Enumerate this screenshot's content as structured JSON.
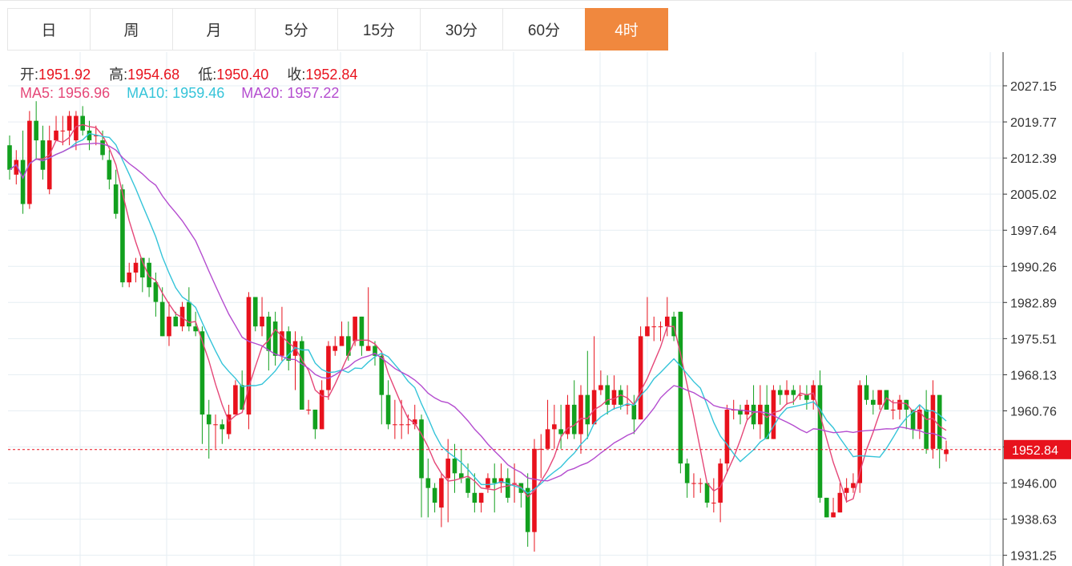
{
  "tabs": [
    {
      "label": "日",
      "active": false
    },
    {
      "label": "周",
      "active": false
    },
    {
      "label": "月",
      "active": false
    },
    {
      "label": "5分",
      "active": false
    },
    {
      "label": "15分",
      "active": false
    },
    {
      "label": "30分",
      "active": false
    },
    {
      "label": "60分",
      "active": false
    },
    {
      "label": "4时",
      "active": true
    }
  ],
  "ohlc": {
    "open_label": "开:",
    "open": "1951.92",
    "high_label": "高:",
    "high": "1954.68",
    "low_label": "低:",
    "low": "1950.40",
    "close_label": "收:",
    "close": "1952.84"
  },
  "ma": {
    "ma5_label": "MA5:",
    "ma5": "1956.96",
    "ma10_label": "MA10:",
    "ma10": "1959.46",
    "ma20_label": "MA20:",
    "ma20": "1957.22"
  },
  "colors": {
    "up": "#e8121d",
    "down": "#12a01e",
    "ma5": "#e54778",
    "ma10": "#35c4d9",
    "ma20": "#b44ccf",
    "grid": "#e6eef3",
    "active_tab": "#f0883e"
  },
  "chart_data": {
    "type": "candlestick",
    "y_ticks": [
      "2027.15",
      "2019.77",
      "2012.39",
      "2005.02",
      "1997.64",
      "1990.26",
      "1982.89",
      "1975.51",
      "1968.13",
      "1960.76",
      "1953.38",
      "1946.00",
      "1938.63",
      "1931.25"
    ],
    "ylim": [
      1931.25,
      2027.15
    ],
    "last_price": "1952.84",
    "candles": [
      [
        2015,
        2010,
        2017,
        2008
      ],
      [
        2009,
        2012,
        2014,
        2007
      ],
      [
        2012,
        2003,
        2018,
        2001
      ],
      [
        2003,
        2020,
        2022,
        2002
      ],
      [
        2020,
        2016,
        2024,
        2012
      ],
      [
        2016,
        2010,
        2019,
        2008
      ],
      [
        2006,
        2016,
        2019,
        2005
      ],
      [
        2016,
        2018,
        2021,
        2016
      ],
      [
        2018,
        2018,
        2021,
        2015
      ],
      [
        2018,
        2021,
        2022,
        2015
      ],
      [
        2016,
        2021,
        2022,
        2014
      ],
      [
        2021,
        2018,
        2023,
        2017
      ],
      [
        2018,
        2016,
        2020,
        2014
      ],
      [
        2017,
        2017,
        2019,
        2015
      ],
      [
        2016,
        2013,
        2018,
        2012
      ],
      [
        2012,
        2008,
        2014,
        2006
      ],
      [
        2007,
        2001,
        2010,
        2000
      ],
      [
        2006,
        1987,
        2007,
        1986
      ],
      [
        1987,
        1989,
        1991,
        1986
      ],
      [
        1989,
        1991,
        1992,
        1987
      ],
      [
        1992,
        1988,
        1992,
        1985
      ],
      [
        1991,
        1986,
        1992,
        1984
      ],
      [
        1987,
        1983,
        1989,
        1980
      ],
      [
        1983,
        1976,
        1986,
        1976
      ],
      [
        1976,
        1980,
        1983,
        1974
      ],
      [
        1980,
        1978,
        1981,
        1978
      ],
      [
        1978,
        1982,
        1983,
        1977
      ],
      [
        1983,
        1978,
        1986,
        1977
      ],
      [
        1978,
        1977,
        1981,
        1976
      ],
      [
        1977,
        1960,
        1978,
        1954
      ],
      [
        1960,
        1958,
        1963,
        1951
      ],
      [
        1958,
        1958,
        1960,
        1953
      ],
      [
        1958,
        1957,
        1959,
        1954
      ],
      [
        1956,
        1960,
        1962,
        1955
      ],
      [
        1960,
        1966,
        1967,
        1960
      ],
      [
        1966,
        1961,
        1969,
        1961
      ],
      [
        1960,
        1984,
        1985,
        1957
      ],
      [
        1984,
        1978,
        1984,
        1977
      ],
      [
        1978,
        1980,
        1984,
        1976
      ],
      [
        1980,
        1973,
        1981,
        1969
      ],
      [
        1979,
        1972,
        1981,
        1970
      ],
      [
        1972,
        1977,
        1982,
        1971
      ],
      [
        1977,
        1971,
        1978,
        1969
      ],
      [
        1972,
        1975,
        1977,
        1965
      ],
      [
        1975,
        1961,
        1976,
        1961
      ],
      [
        1961,
        1961,
        1963,
        1960
      ],
      [
        1961,
        1957,
        1961,
        1955
      ],
      [
        1957,
        1965,
        1967,
        1957
      ],
      [
        1965,
        1974,
        1975,
        1963
      ],
      [
        1973,
        1974,
        1976,
        1972
      ],
      [
        1974,
        1976,
        1979,
        1975
      ],
      [
        1976,
        1972,
        1979,
        1971
      ],
      [
        1975,
        1980,
        1980,
        1974
      ],
      [
        1980,
        1974,
        1980,
        1972
      ],
      [
        1973,
        1974,
        1986,
        1973
      ],
      [
        1974,
        1972,
        1975,
        1970
      ],
      [
        1972,
        1964,
        1973,
        1958
      ],
      [
        1964,
        1958,
        1967,
        1957
      ],
      [
        1958,
        1958,
        1963,
        1955
      ],
      [
        1958,
        1958,
        1963,
        1955
      ],
      [
        1958,
        1958,
        1960,
        1956
      ],
      [
        1958,
        1959,
        1962,
        1957
      ],
      [
        1959,
        1947,
        1960,
        1939
      ],
      [
        1947,
        1945,
        1951,
        1939
      ],
      [
        1945,
        1942,
        1946,
        1940
      ],
      [
        1941,
        1947,
        1948,
        1937
      ],
      [
        1947,
        1951,
        1955,
        1938
      ],
      [
        1951,
        1948,
        1954,
        1944
      ],
      [
        1948,
        1947,
        1953,
        1946
      ],
      [
        1947,
        1944,
        1950,
        1943
      ],
      [
        1944,
        1942,
        1948,
        1940
      ],
      [
        1942,
        1944,
        1944,
        1940
      ],
      [
        1945,
        1947,
        1948,
        1944
      ],
      [
        1947,
        1946,
        1950,
        1940
      ],
      [
        1946,
        1947,
        1950,
        1944
      ],
      [
        1947,
        1943,
        1949,
        1942
      ],
      [
        1946,
        1946,
        1950,
        1942
      ],
      [
        1946,
        1944,
        1946,
        1941
      ],
      [
        1945,
        1936,
        1948,
        1933
      ],
      [
        1936,
        1953,
        1955,
        1932
      ],
      [
        1953,
        1953,
        1956,
        1947
      ],
      [
        1953,
        1957,
        1963,
        1956
      ],
      [
        1957,
        1958,
        1962,
        1953
      ],
      [
        1957,
        1956,
        1962,
        1953
      ],
      [
        1956,
        1962,
        1964,
        1955
      ],
      [
        1962,
        1956,
        1967,
        1955
      ],
      [
        1956,
        1964,
        1966,
        1952
      ],
      [
        1964,
        1958,
        1973,
        1955
      ],
      [
        1958,
        1965,
        1976,
        1962
      ],
      [
        1965,
        1966,
        1969,
        1964
      ],
      [
        1966,
        1962,
        1968,
        1960
      ],
      [
        1962,
        1965,
        1968,
        1961
      ],
      [
        1965,
        1962,
        1966,
        1961
      ],
      [
        1962,
        1962,
        1966,
        1960
      ],
      [
        1962,
        1959,
        1964,
        1956
      ],
      [
        1959,
        1976,
        1978,
        1959
      ],
      [
        1976,
        1978,
        1984,
        1976
      ],
      [
        1978,
        1978,
        1980,
        1975
      ],
      [
        1978,
        1978,
        1979,
        1975
      ],
      [
        1978,
        1980,
        1984,
        1976
      ],
      [
        1980,
        1976,
        1981,
        1975
      ],
      [
        1981,
        1950,
        1981,
        1948
      ],
      [
        1950,
        1946,
        1951,
        1943
      ],
      [
        1946,
        1946,
        1948,
        1943
      ],
      [
        1946,
        1946,
        1947,
        1944
      ],
      [
        1946,
        1942,
        1946,
        1941
      ],
      [
        1942,
        1942,
        1947,
        1940
      ],
      [
        1942,
        1950,
        1951,
        1938
      ],
      [
        1950,
        1961,
        1962,
        1948
      ],
      [
        1961,
        1961,
        1963,
        1959
      ],
      [
        1961,
        1960,
        1962,
        1958
      ],
      [
        1960,
        1962,
        1963,
        1959
      ],
      [
        1962,
        1958,
        1966,
        1957
      ],
      [
        1958,
        1962,
        1966,
        1955
      ],
      [
        1962,
        1955,
        1966,
        1955
      ],
      [
        1955,
        1965,
        1966,
        1955
      ],
      [
        1965,
        1964,
        1966,
        1962
      ],
      [
        1964,
        1965,
        1967,
        1962
      ],
      [
        1965,
        1964,
        1966,
        1962
      ],
      [
        1964,
        1964,
        1966,
        1963
      ],
      [
        1964,
        1963,
        1966,
        1961
      ],
      [
        1963,
        1966,
        1967,
        1961
      ],
      [
        1966,
        1943,
        1969,
        1942
      ],
      [
        1943,
        1939,
        1943,
        1939
      ],
      [
        1939,
        1940,
        1943,
        1939
      ],
      [
        1940,
        1944,
        1946,
        1940
      ],
      [
        1944,
        1945,
        1947,
        1942
      ],
      [
        1945,
        1946,
        1948,
        1944
      ],
      [
        1946,
        1966,
        1967,
        1944
      ],
      [
        1966,
        1963,
        1968,
        1962
      ],
      [
        1963,
        1962,
        1965,
        1960
      ],
      [
        1962,
        1965,
        1965,
        1961
      ],
      [
        1965,
        1961,
        1965,
        1961
      ],
      [
        1961,
        1961,
        1963,
        1959
      ],
      [
        1961,
        1963,
        1964,
        1959
      ],
      [
        1963,
        1961,
        1963,
        1957
      ],
      [
        1961,
        1957,
        1961,
        1955
      ],
      [
        1957,
        1961,
        1962,
        1955
      ],
      [
        1961,
        1953,
        1965,
        1952
      ],
      [
        1953,
        1964,
        1967,
        1951
      ],
      [
        1964,
        1953,
        1964,
        1949
      ],
      [
        1951.92,
        1952.84,
        1954.68,
        1950.4
      ]
    ]
  }
}
